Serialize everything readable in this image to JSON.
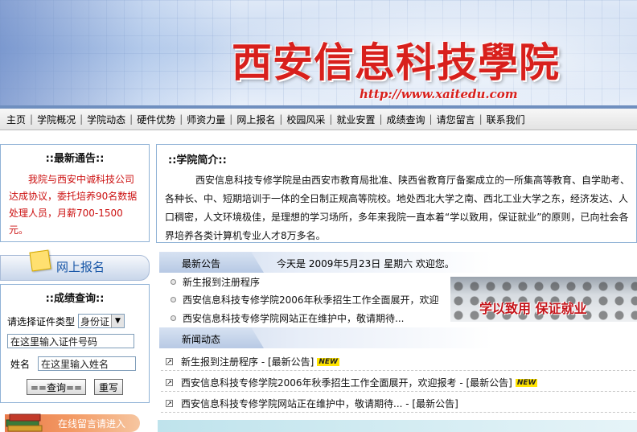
{
  "header": {
    "school_name": "西安信息科技學院",
    "url": "http://www.xaitedu.com"
  },
  "nav": {
    "items": [
      "主页",
      "学院概况",
      "学院动态",
      "硬件优势",
      "师资力量",
      "网上报名",
      "校园风采",
      "就业安置",
      "成绩查询",
      "请您留言",
      "联系我们"
    ]
  },
  "notice": {
    "title": "::最新通告::",
    "text": "我院与西安中诚科技公司达成协议，委托培养90名数据处理人员，月薪700-1500元。"
  },
  "signup": {
    "label": "网上报名"
  },
  "grade_query": {
    "title": "::成绩查询::",
    "id_type_label": "请选择证件类型",
    "id_type_value": "身份证",
    "id_placeholder": "在这里输入证件号码",
    "name_label": "姓名",
    "name_placeholder": "在这里输入姓名",
    "query_button": "==查询==",
    "reset_button": "重写"
  },
  "message": {
    "label": "在线留言请进入"
  },
  "intro": {
    "title": "::学院简介::",
    "text": "西安信息科技专修学院是由西安市教育局批准、陕西省教育厅备案成立的一所集高等教育、自学助考、各种长、中、短期培训于一体的全日制正规高等院校。地处西北大学之南、西北工业大学之东，经济发达、人口稠密，人文环境极佳，是理想的学习场所，多年来我院一直本着“学以致用，保证就业”的原则，已向社会各界培养各类计算机专业人才8万多名。"
  },
  "announcements": {
    "title": "最新公告",
    "today": "今天是  2009年5月23日  星期六  欢迎您。",
    "items": [
      "新生报到注册程序",
      "西安信息科技专修学院2006年秋季招生工作全面展开，欢迎",
      "西安信息科技专修学院网站正在维护中，敬请期待..."
    ],
    "slogan": "学以致用 保证就业"
  },
  "news": {
    "title": "新闻动态",
    "badge": "NEW",
    "items": [
      "新生报到注册程序 - [最新公告]",
      "西安信息科技专修学院2006年秋季招生工作全面展开，欢迎报考 - [最新公告]",
      "西安信息科技专修学院网站正在维护中，敬请期待... - [最新公告]"
    ]
  }
}
